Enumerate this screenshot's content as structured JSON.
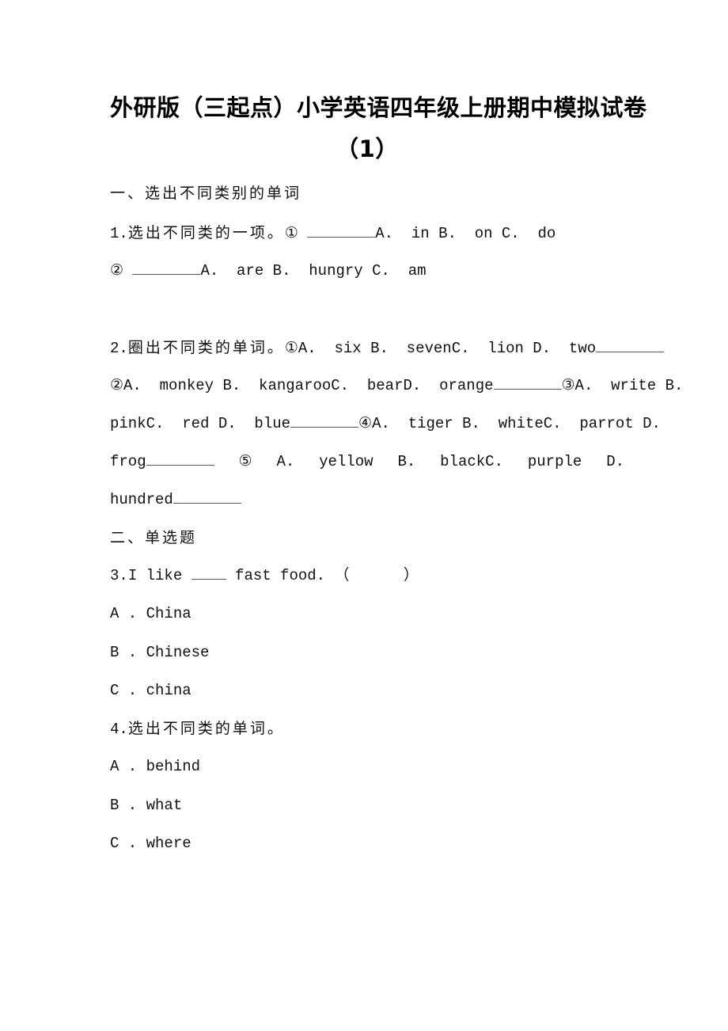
{
  "document": {
    "title_line1": "外研版（三起点）小学英语四年级上册期中模拟试卷",
    "title_line2": "（1）",
    "section1": {
      "heading": "一、选出不同类别的单词",
      "q1": {
        "number": "1.",
        "prompt": "选出不同类的一项。",
        "parts": [
          {
            "marker": "①",
            "options": "A.  in B.  on C.  do"
          },
          {
            "marker": "②",
            "options": "A.  are B.  hungry C.  am"
          }
        ]
      },
      "q2": {
        "number": "2.",
        "prompt": "圈出不同类的单词。",
        "line1": "①A.  six B.  sevenC.  lion D.  two",
        "line2a": "②A.  monkey B.  kangarooC.  bearD.  orange",
        "line2b": "③A.  write B.",
        "line3a": "pinkC.  red D.  blue",
        "line3b": "④A.  tiger B.  whiteC.  parrot D.",
        "line4_tokens": [
          "frog",
          "⑤",
          "A.",
          "yellow",
          "B.",
          "blackC.",
          "purple",
          "D."
        ],
        "line5": "hundred"
      }
    },
    "section2": {
      "heading": "二、单选题",
      "q3": {
        "number": "3.",
        "prompt_before": "I like ",
        "prompt_after": " fast food. （      ）",
        "options": [
          "A . China",
          "B . Chinese",
          "C . china"
        ]
      },
      "q4": {
        "number": "4.",
        "prompt": "选出不同类的单词。",
        "options": [
          "A . behind",
          "B . what",
          "C . where"
        ]
      }
    }
  }
}
